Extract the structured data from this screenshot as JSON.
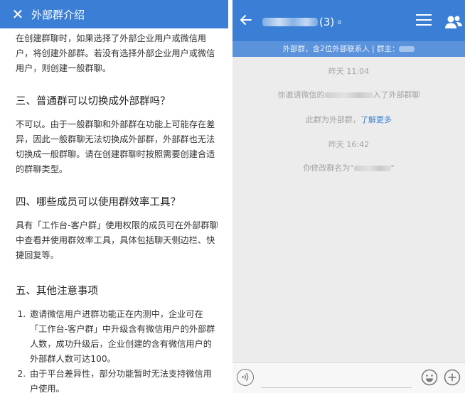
{
  "article": {
    "header_title": "外部群介绍",
    "intro_text": "在创建群聊时，如果选择了外部企业用户或微信用户，将创建外部群。若没有选择外部企业用户或微信用户，则创建一般群聊。",
    "sections": [
      {
        "title": "三、普通群可以切换成外部群吗？",
        "body": "不可以。由于一般群聊和外部群在功能上可能存在差异，因此一般群聊无法切换成外部群，外部群也无法切换成一般群聊。请在创建群聊时按照需要创建合适的群聊类型。"
      },
      {
        "title": "四、哪些成员可以使用群效率工具？",
        "body": "具有「工作台-客户群」使用权限的成员可在外部群聊中查看并使用群效率工具，具体包括聊天侧边栏、快捷回复等。"
      },
      {
        "title": "五、其他注意事项",
        "items": [
          "邀请微信用户进群功能正在内测中，企业可在「工作台-客户群」中升级含有微信用户的外部群人数，成功升级后，企业创建的含有微信用户的外部群人数可达100。",
          "由于平台差异性，部分功能暂时无法支持微信用户使用。"
        ]
      }
    ]
  },
  "chat": {
    "title_count": "(3)",
    "title_mark": "a",
    "subheader_text": "外部群，含2位外部联系人 | 群主：",
    "messages": {
      "time_1": "昨天 11:04",
      "invite_prefix": "你邀请微信的",
      "invite_suffix": "入了外部群聊",
      "notice_text": "此群为外部群，",
      "notice_link": "了解更多",
      "time_2": "昨天 16:42",
      "rename_prefix": "你修改群名为\"",
      "rename_suffix": "\""
    }
  },
  "icons": {
    "close": "close-icon",
    "back": "back-arrow-icon",
    "menu": "menu-icon",
    "contacts": "contacts-icon",
    "voice": "voice-icon",
    "emoji": "emoji-icon",
    "plus": "plus-icon"
  },
  "colors": {
    "header_blue": "#3a7fd5",
    "subheader_blue": "#5a93dc",
    "chat_background": "#ececec",
    "system_text": "#a3a3a3"
  }
}
